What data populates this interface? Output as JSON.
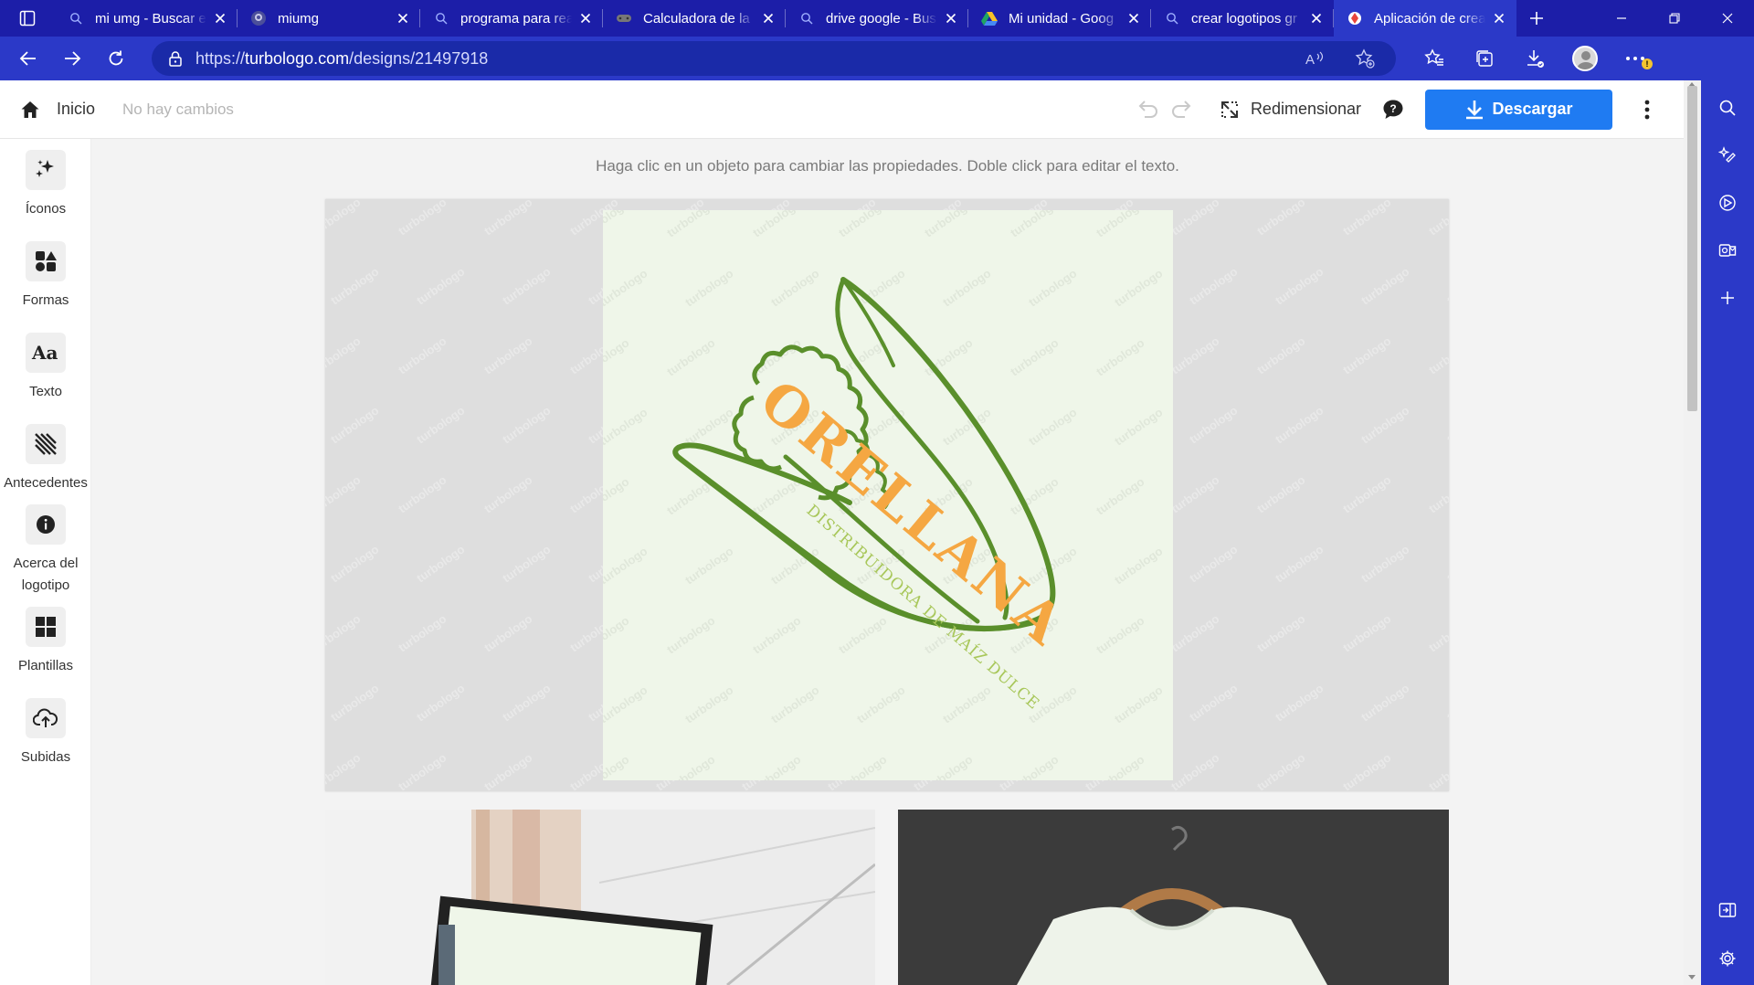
{
  "browser": {
    "tabs": [
      {
        "title": "mi umg - Buscar en",
        "icon": "search-icon",
        "active": false
      },
      {
        "title": "miumg",
        "icon": "globe-icon",
        "active": false
      },
      {
        "title": "programa para rea",
        "icon": "search-icon",
        "active": false
      },
      {
        "title": "Calculadora de la",
        "icon": "gamepad-icon",
        "active": false
      },
      {
        "title": "drive google - Bus",
        "icon": "search-icon",
        "active": false
      },
      {
        "title": "Mi unidad - Goog",
        "icon": "drive-icon",
        "active": false
      },
      {
        "title": "crear logotipos gr",
        "icon": "search-icon",
        "active": false
      },
      {
        "title": "Aplicación de crea",
        "icon": "turbologo-icon",
        "active": true
      }
    ],
    "url_prefix": "https://",
    "url_host": "turbologo.com",
    "url_path": "/designs/21497918",
    "colors": {
      "frame": "#1c1ea8",
      "toolbar": "#2b39c8",
      "omnibox": "#1a2aa8"
    }
  },
  "app": {
    "home_label": "Inicio",
    "status": "No hay cambios",
    "resize_label": "Redimensionar",
    "download_label": "Descargar",
    "hint": "Haga clic en un objeto para cambiar las propiedades. Doble click para editar el texto.",
    "accent_color": "#1f7bf2",
    "tools": [
      {
        "label": "Íconos",
        "icon": "sparkles-icon"
      },
      {
        "label": "Formas",
        "icon": "shapes-icon"
      },
      {
        "label": "Texto",
        "icon": "text-icon"
      },
      {
        "label": "Antecedentes",
        "icon": "background-pattern-icon"
      },
      {
        "label": "Acerca del logotipo",
        "icon": "info-icon"
      },
      {
        "label": "Plantillas",
        "icon": "templates-icon"
      },
      {
        "label": "Subidas",
        "icon": "upload-cloud-icon"
      }
    ]
  },
  "logo": {
    "name": "ORELLANA",
    "tagline": "DISTRIBUIDORA DE MAÍZ DULCE",
    "watermark": "turbologo",
    "colors": {
      "husk": "#5a8f2b",
      "name": "#f5a742",
      "tagline": "#a8c75a",
      "background": "#eff6e9"
    }
  }
}
